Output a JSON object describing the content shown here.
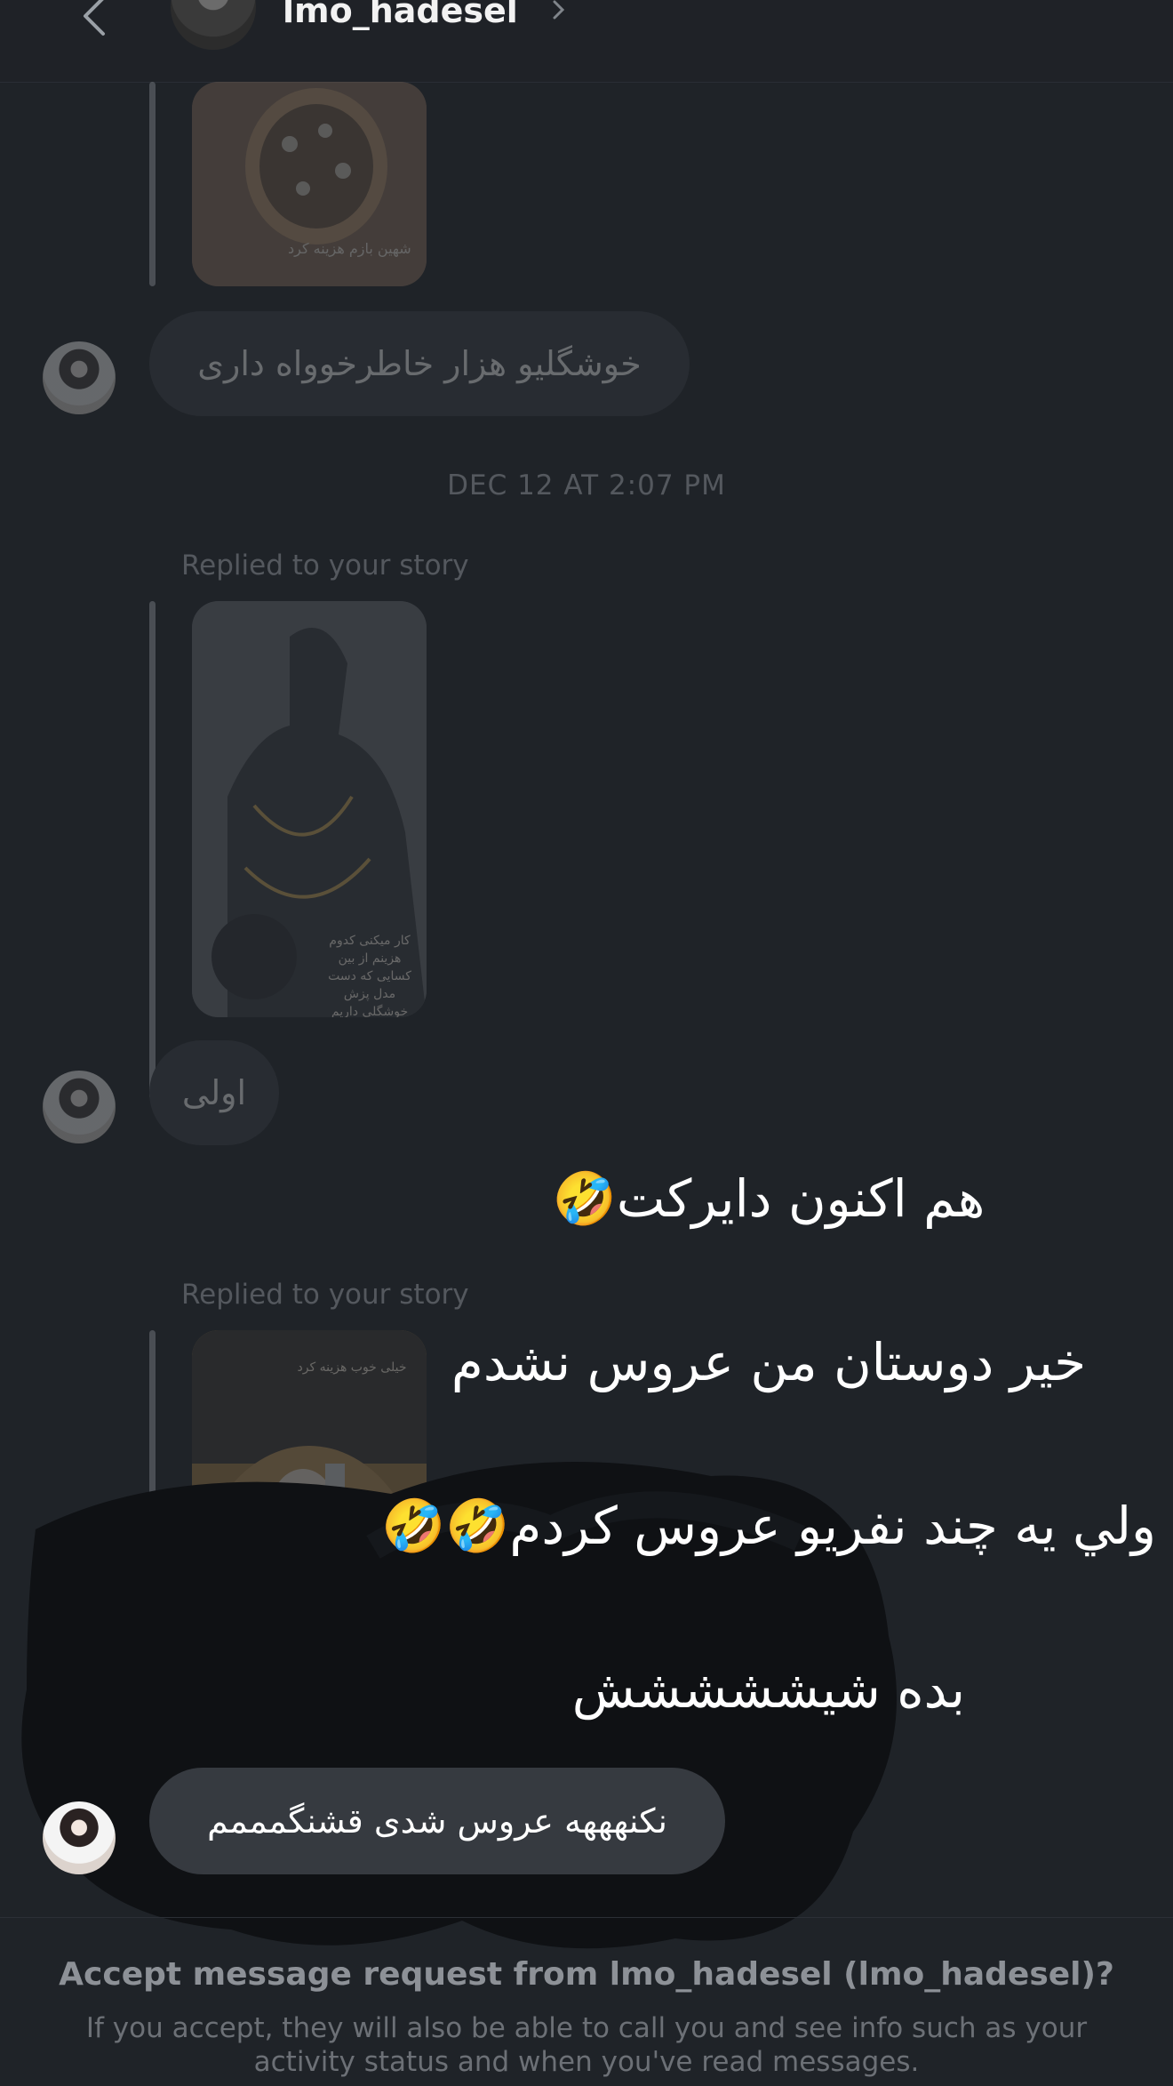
{
  "header": {
    "username": "lmo_hadesel"
  },
  "thread": {
    "story_caption_1": "شهین بازم هزینه کرد",
    "message_1": "خوشگلیو هزار خاطرخوواه داری",
    "timestamp": "DEC 12 AT 2:07 PM",
    "replied_label_1": "Replied to your story",
    "story_caption_2": "کار میکنی کدوم هزینم از بین کسایی که دست مدل پزش خوشگلي داریم",
    "message_2": "اولی",
    "replied_label_2": "Replied to your story",
    "story_caption_3": "خیلی خوب هزینه کرد",
    "last_message": "نکنهههه عروس شدی قشنگمممم"
  },
  "overlay": {
    "line_1": "هم اکنون دایرکت🤣",
    "line_2": "خیر دوستان من عروس نشدم",
    "line_3": "ولي يه چند نفریو عروس کردم🤣🤣",
    "line_4": "بده شیششششش"
  },
  "footer": {
    "accept_title": "Accept message request from lmo_hadesel (lmo_hadesel)?",
    "accept_subtitle": "If you accept, they will also be able to call you and see info such as your activity status and when you've read messages."
  },
  "colors": {
    "background": "#1f2328",
    "bubble": "#363a40",
    "text_muted": "#8d9197"
  }
}
